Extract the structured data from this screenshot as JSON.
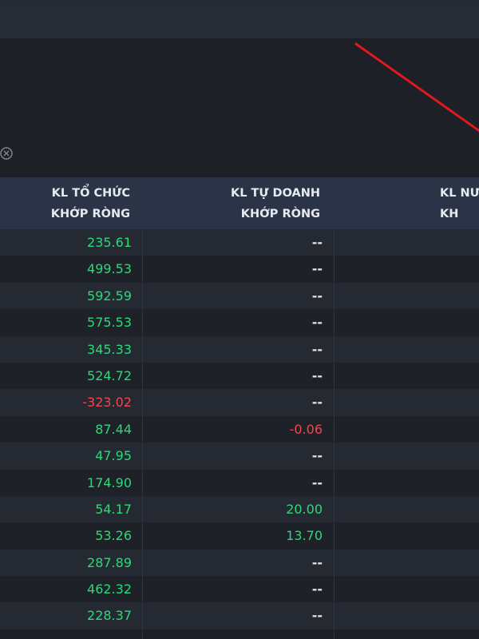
{
  "table": {
    "columns": [
      {
        "line1": "KL TỔ CHỨC",
        "line2": "KHỚP RÒNG"
      },
      {
        "line1": "KL TỰ DOANH",
        "line2": "KHỚP RÒNG"
      },
      {
        "line1": "KL NƯỚ",
        "line2": "KH"
      }
    ],
    "rows": [
      {
        "org": "235.61",
        "org_sign": "pos",
        "prop": "--",
        "prop_sign": "dash"
      },
      {
        "org": "499.53",
        "org_sign": "pos",
        "prop": "--",
        "prop_sign": "dash"
      },
      {
        "org": "592.59",
        "org_sign": "pos",
        "prop": "--",
        "prop_sign": "dash"
      },
      {
        "org": "575.53",
        "org_sign": "pos",
        "prop": "--",
        "prop_sign": "dash"
      },
      {
        "org": "345.33",
        "org_sign": "pos",
        "prop": "--",
        "prop_sign": "dash"
      },
      {
        "org": "524.72",
        "org_sign": "pos",
        "prop": "--",
        "prop_sign": "dash"
      },
      {
        "org": "-323.02",
        "org_sign": "neg",
        "prop": "--",
        "prop_sign": "dash"
      },
      {
        "org": "87.44",
        "org_sign": "pos",
        "prop": "-0.06",
        "prop_sign": "neg"
      },
      {
        "org": "47.95",
        "org_sign": "pos",
        "prop": "--",
        "prop_sign": "dash"
      },
      {
        "org": "174.90",
        "org_sign": "pos",
        "prop": "--",
        "prop_sign": "dash"
      },
      {
        "org": "54.17",
        "org_sign": "pos",
        "prop": "20.00",
        "prop_sign": "pos"
      },
      {
        "org": "53.26",
        "org_sign": "pos",
        "prop": "13.70",
        "prop_sign": "pos"
      },
      {
        "org": "287.89",
        "org_sign": "pos",
        "prop": "--",
        "prop_sign": "dash"
      },
      {
        "org": "462.32",
        "org_sign": "pos",
        "prop": "--",
        "prop_sign": "dash"
      },
      {
        "org": "228.37",
        "org_sign": "pos",
        "prop": "--",
        "prop_sign": "dash"
      }
    ]
  },
  "colors": {
    "positive": "#2bd97a",
    "negative": "#f0474f",
    "header_bg": "#2a3446",
    "annotation_line": "#e0191f"
  },
  "icons": {
    "clear": "close-icon"
  }
}
